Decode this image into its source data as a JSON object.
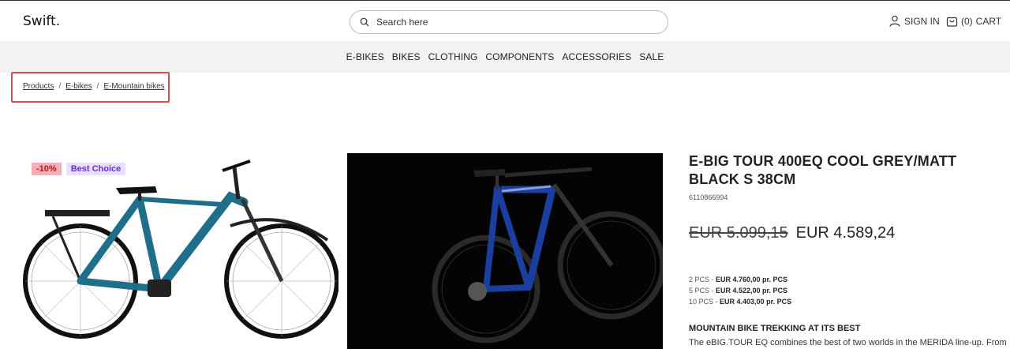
{
  "header": {
    "logo": "Swift.",
    "search_placeholder": "Search here",
    "signin_label": "SIGN IN",
    "cart_count": "(0)",
    "cart_label": "CART"
  },
  "nav": {
    "items": [
      "E-BIKES",
      "BIKES",
      "CLOTHING",
      "COMPONENTS",
      "ACCESSORIES",
      "SALE"
    ]
  },
  "breadcrumb": [
    "Products",
    "E-bikes",
    "E-Mountain bikes"
  ],
  "product": {
    "badges": {
      "sale": "-10%",
      "choice": "Best Choice"
    },
    "title": "E-BIG TOUR 400EQ COOL GREY/MATT BLACK S 38CM",
    "sku": "6110866994",
    "old_price": "EUR 5.099,15",
    "new_price": "EUR 4.589,24",
    "tiers": [
      {
        "qty": "2 PCS",
        "price": "EUR 4.760,00 pr. PCS"
      },
      {
        "qty": "5 PCS",
        "price": "EUR 4.522,00 pr. PCS"
      },
      {
        "qty": "10 PCS",
        "price": "EUR 4.403,00 pr. PCS"
      }
    ],
    "desc_title": "MOUNTAIN BIKE TREKKING AT ITS BEST",
    "desc_text": "The eBIG.TOUR EQ combines the best of two worlds in the MERIDA line-up. From"
  },
  "colors": {
    "highlight_box": "#e04b50",
    "bike_left_frame": "#1f6f8b",
    "bike_right_frame": "#1b3fa0"
  }
}
